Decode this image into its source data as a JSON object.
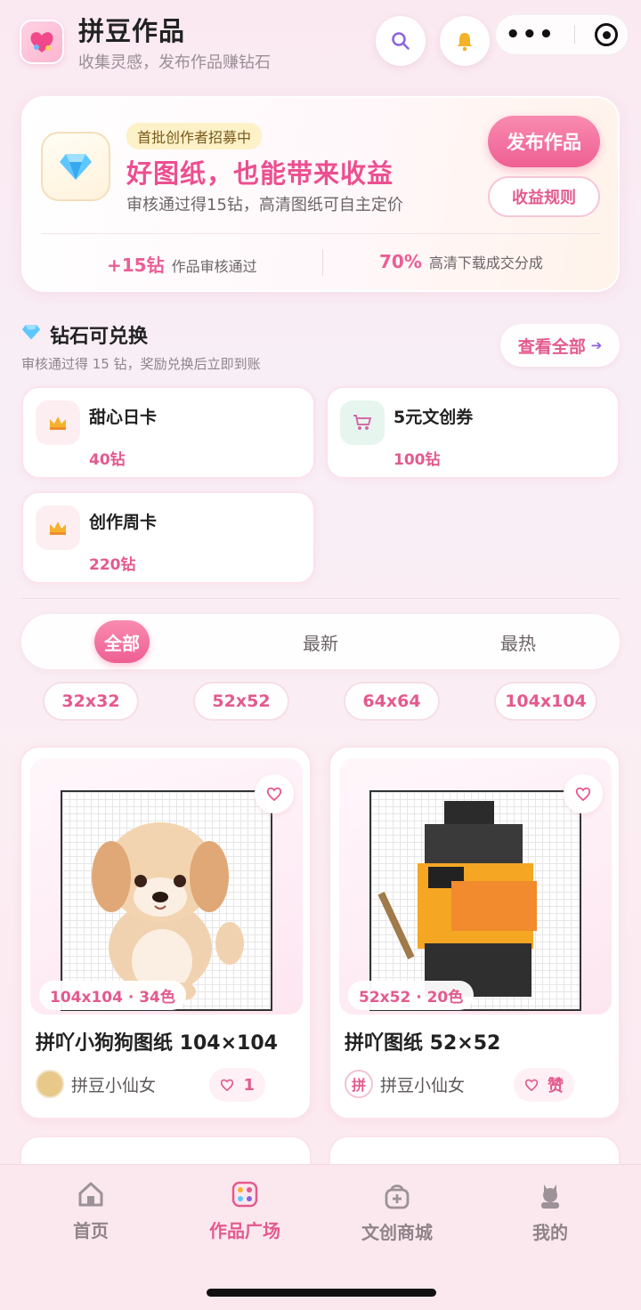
{
  "header": {
    "title": "拼豆作品",
    "subtitle": "收集灵感，发布作品赚钻石"
  },
  "promo": {
    "badge": "首批创作者招募中",
    "title": "好图纸，也能带来收益",
    "description": "审核通过得15钻，高清图纸可自主定价",
    "publish_label": "发布作品",
    "rules_label": "收益规则",
    "stats": [
      {
        "value": "+15钻",
        "label": "作品审核通过"
      },
      {
        "value": "70%",
        "label": "高清下载成交分成"
      }
    ]
  },
  "exchange": {
    "title": "钻石可兑换",
    "subtitle": "审核通过得 15 钻，奖励兑换后立即到账",
    "view_all_label": "查看全部",
    "items": [
      {
        "name": "甜心日卡",
        "cost": "40钻",
        "icon": "crown-icon"
      },
      {
        "name": "5元文创券",
        "cost": "100钻",
        "icon": "cart-icon"
      },
      {
        "name": "创作周卡",
        "cost": "220钻",
        "icon": "crown-icon"
      }
    ]
  },
  "filters": {
    "tabs": [
      {
        "label": "全部",
        "active": true
      },
      {
        "label": "最新",
        "active": false
      },
      {
        "label": "最热",
        "active": false
      }
    ],
    "sizes": [
      "32x32",
      "52x52",
      "64x64",
      "104x104"
    ]
  },
  "works": [
    {
      "title": "拼吖小狗狗图纸 104×104",
      "meta": "104x104 · 34色",
      "author": "拼豆小仙女",
      "likes": "1"
    },
    {
      "title": "拼吖图纸 52×52",
      "meta": "52x52 · 20色",
      "author": "拼豆小仙女",
      "likes": "赞",
      "avatar_text": "拼"
    }
  ],
  "bottom_nav": [
    {
      "label": "首页",
      "icon": "home-icon",
      "active": false
    },
    {
      "label": "作品广场",
      "icon": "gallery-icon",
      "active": true
    },
    {
      "label": "文创商城",
      "icon": "shop-bag-icon",
      "active": false
    },
    {
      "label": "我的",
      "icon": "profile-icon",
      "active": false
    }
  ],
  "colors": {
    "accent": "#ee5f92",
    "accent_text": "#e35a8e"
  }
}
